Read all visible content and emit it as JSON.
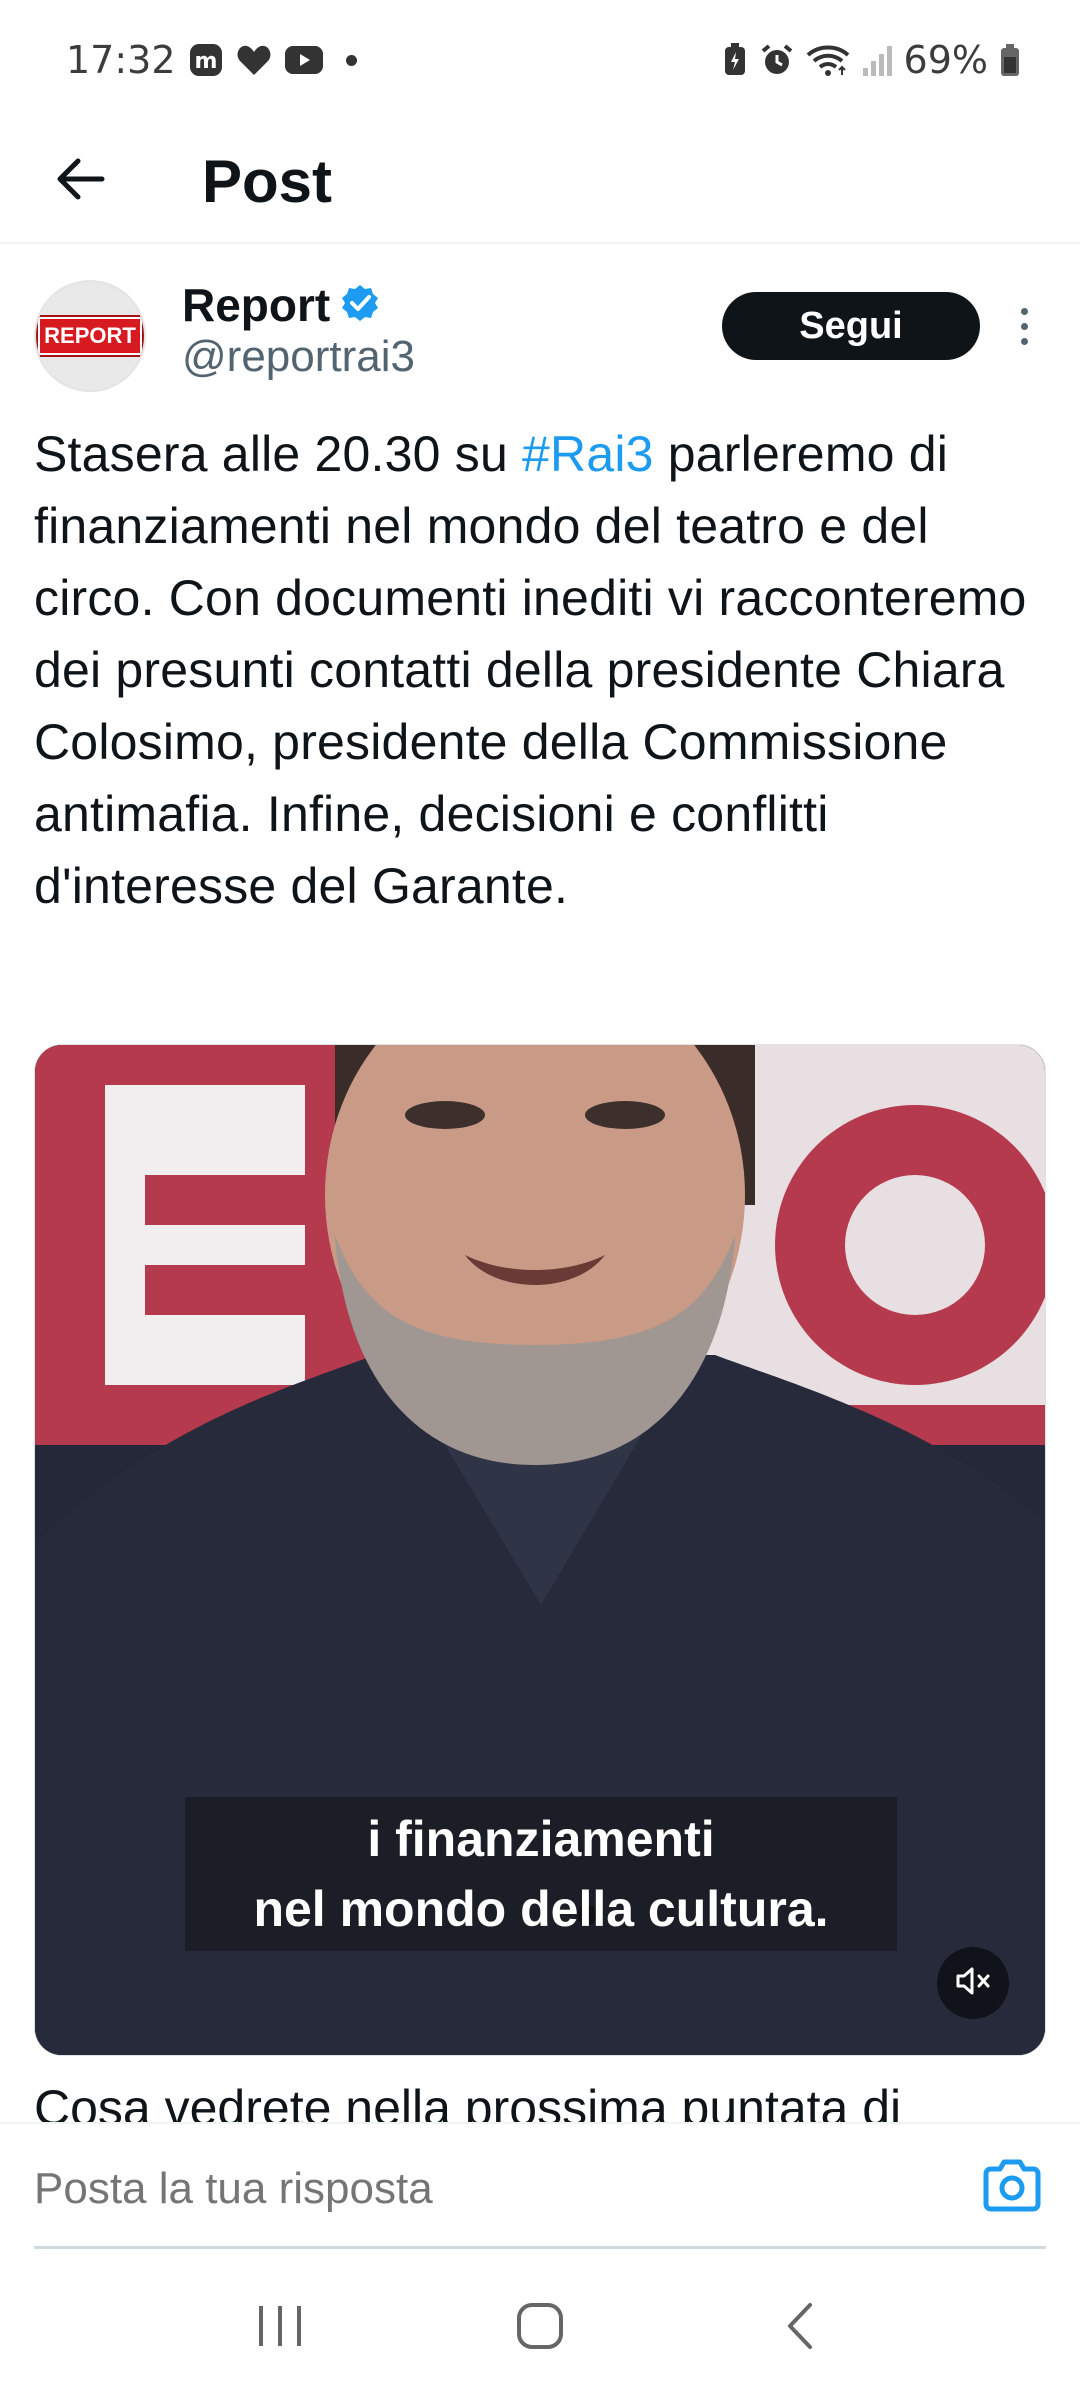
{
  "status_bar": {
    "time": "17:32",
    "battery_percent": "69%",
    "icons": [
      "mastodon-icon",
      "heart-icon",
      "youtube-icon",
      "notification-dot",
      "battery-saver-icon",
      "alarm-icon",
      "wifi-icon",
      "signal-icon",
      "battery-icon"
    ]
  },
  "top_bar": {
    "title": "Post",
    "back_icon": "arrow-left-icon"
  },
  "post": {
    "author": {
      "display_name": "Report",
      "handle": "@reportrai3",
      "verified": true,
      "avatar_logo_text": "REPORT"
    },
    "follow_label": "Segui",
    "text_before_hashtag": "Stasera alle 20.30 su ",
    "hashtag": "#Rai3",
    "text_after_hashtag": " parleremo di finanziamenti nel mondo del teatro e del circo. Con documenti inediti vi racconteremo dei presunti contatti della presidente Chiara Colosimo, presidente della Commissione antimafia. Infine, decisioni e conflitti d'interesse del Garante.",
    "video": {
      "subtitle_line1": "i finanziamenti",
      "subtitle_line2": "nel mondo della cultura.",
      "mute_icon": "volume-muted-icon"
    },
    "next_text": "Cosa vedrete nella prossima puntata di"
  },
  "reply": {
    "placeholder": "Posta la tua risposta",
    "camera_icon": "camera-icon"
  },
  "nav_bar": {
    "icons": [
      "recent-apps-icon",
      "home-icon",
      "back-icon"
    ]
  },
  "colors": {
    "accent": "#1d9bf0",
    "text_primary": "#0f1419",
    "text_secondary": "#536471",
    "follow_bg": "#0f1419"
  }
}
